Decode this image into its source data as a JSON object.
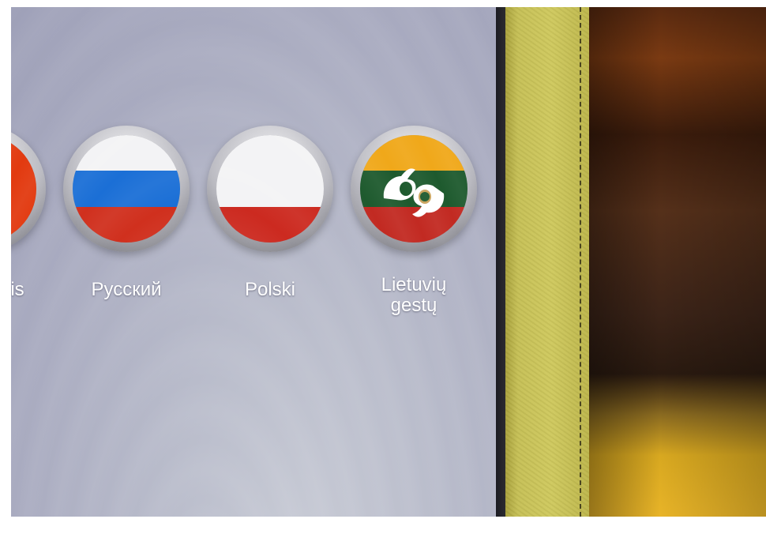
{
  "languages": [
    {
      "id": "partial",
      "label": "is",
      "stripes": [
        "#e23a10",
        "#e23a10",
        "#e23a10"
      ]
    },
    {
      "id": "russian",
      "label": "Русский",
      "stripes": [
        "#f3f3f5",
        "#1b6fd6",
        "#d0301e"
      ]
    },
    {
      "id": "polish",
      "label": "Polski",
      "stripes": [
        "#f3f3f5",
        "#f3f3f5",
        "#cc2a20"
      ]
    },
    {
      "id": "lithuanian-sign",
      "label_line1": "Lietuvių",
      "label_line2": "gestų",
      "stripes": [
        "#f0a81a",
        "#1e5a2e",
        "#c22a22"
      ],
      "icon": "sign-language-hands-icon"
    }
  ],
  "colors": {
    "screen": "#a9abc0",
    "leather": "#cfc95e",
    "bezel": "#1c1c22"
  }
}
